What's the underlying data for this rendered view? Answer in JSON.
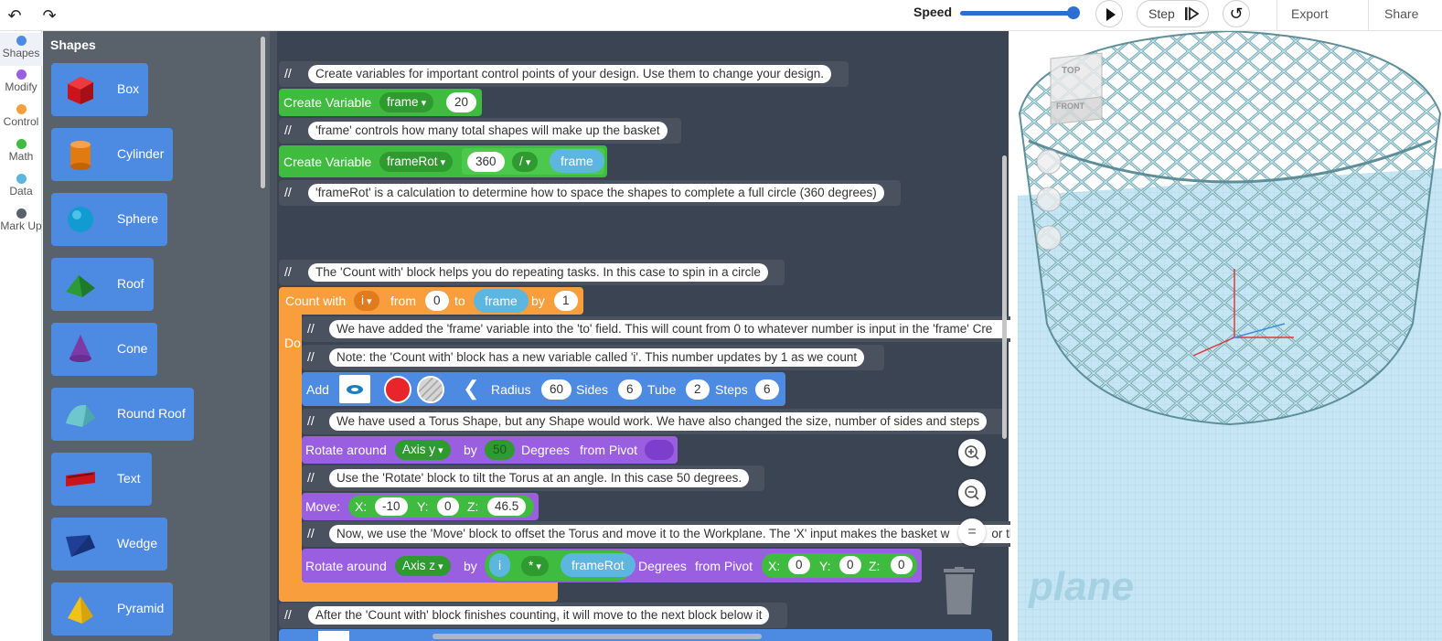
{
  "topbar": {
    "undo_icon": "undo-arrow-icon",
    "redo_icon": "redo-arrow-icon",
    "speed_label": "Speed",
    "speed_value": 1.0,
    "play_icon": "play-icon",
    "step_label": "Step",
    "step_icon": "step-forward-icon",
    "reset_icon": "rewind-icon",
    "export_label": "Export",
    "share_label": "Share"
  },
  "categories": [
    {
      "label": "Shapes",
      "color": "#4d8be2"
    },
    {
      "label": "Modify",
      "color": "#9a5ee0"
    },
    {
      "label": "Control",
      "color": "#f89e3d"
    },
    {
      "label": "Math",
      "color": "#3fbb3f"
    },
    {
      "label": "Data",
      "color": "#5cb6e0"
    },
    {
      "label": "Mark Up",
      "color": "#59616b"
    }
  ],
  "flyout": {
    "title": "Shapes",
    "items": [
      "Box",
      "Cylinder",
      "Sphere",
      "Roof",
      "Cone",
      "Round Roof",
      "Text",
      "Wedge",
      "Pyramid"
    ]
  },
  "code": {
    "comment_symbol": "//",
    "c1": "Create variables for important control points of your design. Use them to change your design.",
    "var1": {
      "label": "Create Variable",
      "name": "frame",
      "value": "20"
    },
    "c2": "'frame' controls how many total shapes will make up the basket",
    "var2": {
      "label": "Create Variable",
      "name": "frameRot",
      "a": "360",
      "op": "/",
      "b": "frame"
    },
    "c3": "'frameRot' is a calculation to determine how to space the shapes to complete a full circle (360 degrees)",
    "c4": "The 'Count with' block helps you do repeating tasks. In this case to spin in a circle",
    "count": {
      "label": "Count with",
      "var": "i",
      "from_label": "from",
      "from": "0",
      "to_label": "to",
      "to": "frame",
      "by_label": "by",
      "by": "1",
      "do_label": "Do"
    },
    "c5": "We have added the 'frame' variable into the 'to' field. This will count from 0 to whatever number is input in the 'frame' Cre",
    "c6": "Note: the 'Count with' block has a new variable called 'i'. This number updates by 1 as we count",
    "add": {
      "label": "Add",
      "radius_label": "Radius",
      "radius": "60",
      "sides_label": "Sides",
      "sides": "6",
      "tube_label": "Tube",
      "tube": "2",
      "steps_label": "Steps",
      "steps": "6",
      "color": "#e8252b"
    },
    "c7": "We have used a Torus Shape, but any Shape would work. We have also changed the size, number of sides and steps",
    "rot1": {
      "label": "Rotate around",
      "axis": "Axis y",
      "by_label": "by",
      "value": "50",
      "deg_label": "Degrees",
      "pivot_label": "from Pivot"
    },
    "c8": "Use the 'Rotate' block to tilt the Torus at an angle. In this case 50 degrees.",
    "move": {
      "label": "Move:",
      "x_label": "X:",
      "x": "-10",
      "y_label": "Y:",
      "y": "0",
      "z_label": "Z:",
      "z": "46.5"
    },
    "c9": "Now, we use the 'Move' block to offset the Torus and move it to the Workplane. The 'X' input makes the basket w",
    "c9_tail": "or th",
    "rot2": {
      "label": "Rotate around",
      "axis": "Axis z",
      "by_label": "by",
      "a": "i",
      "op": "*",
      "b": "frameRot",
      "deg_label": "Degrees",
      "pivot_label": "from Pivot",
      "x_label": "X:",
      "x": "0",
      "y_label": "Y:",
      "y": "0",
      "z_label": "Z:",
      "z": "0"
    },
    "c10": "After the 'Count with' block finishes counting, it will move to the next block below it"
  },
  "viewport": {
    "viewcube_top": "TOP",
    "viewcube_front": "FRONT",
    "workplane_text": "plane"
  }
}
